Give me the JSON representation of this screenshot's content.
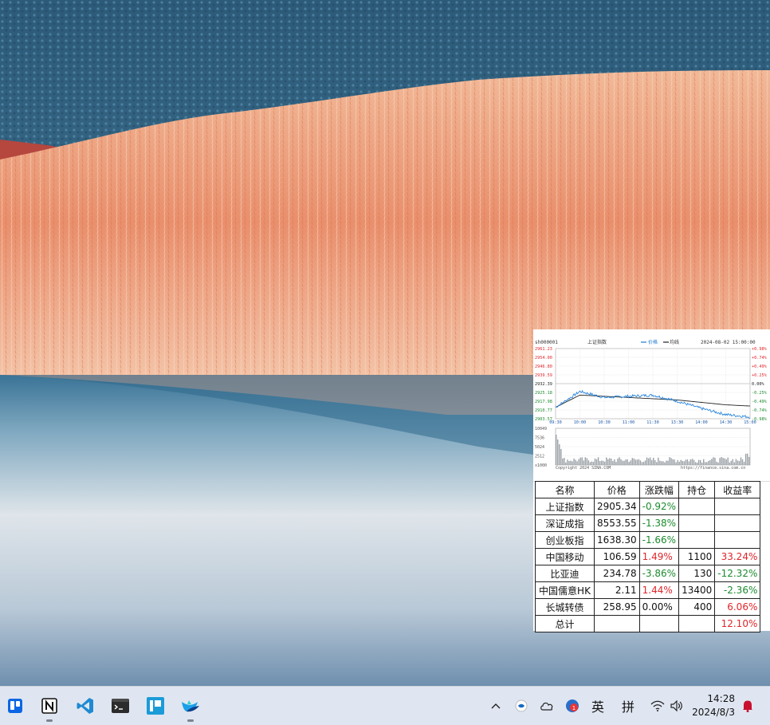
{
  "chart": {
    "symbol": "sh000001",
    "name": "上证指数",
    "legend_price": "价格",
    "legend_avg": "均线",
    "datetime": "2024-08-02 15:00:00",
    "left_ticks": [
      "2961.23",
      "2954.00",
      "2946.80",
      "2939.59",
      "2932.39",
      "2925.18",
      "2917.98",
      "2910.77",
      "2903.57"
    ],
    "right_ticks": [
      "+0.98%",
      "+0.74%",
      "+0.49%",
      "+0.25%",
      "0.00%",
      "-0.25%",
      "-0.49%",
      "-0.74%",
      "-0.98%"
    ],
    "time_ticks": [
      "09:30",
      "10:00",
      "10:30",
      "11:00",
      "11:30",
      "13:30",
      "14:00",
      "14:30",
      "15:00"
    ],
    "volume_ticks": [
      "10049",
      "7536",
      "5024",
      "2512",
      "x1000"
    ],
    "copyright": "Copyright 2024 SINA.COM",
    "source": "https://finance.sina.com.cn"
  },
  "chart_data": {
    "type": "line",
    "title": "上证指数",
    "x": [
      "09:30",
      "10:00",
      "10:30",
      "11:00",
      "11:30",
      "13:30",
      "14:00",
      "14:30",
      "15:00"
    ],
    "series": [
      {
        "name": "价格",
        "values": [
          2913,
          2926,
          2921,
          2922,
          2923,
          2918,
          2912,
          2907,
          2905
        ]
      },
      {
        "name": "均线",
        "values": [
          2913,
          2923,
          2922,
          2921,
          2920,
          2919,
          2917,
          2915,
          2914
        ]
      }
    ],
    "ylim": [
      2903.57,
      2961.23
    ],
    "grid": true
  },
  "table": {
    "headers": [
      "名称",
      "价格",
      "涨跌幅",
      "持仓",
      "收益率"
    ],
    "rows": [
      {
        "name": "上证指数",
        "price": "2905.34",
        "chg": "-0.92%",
        "hold": "",
        "ret": ""
      },
      {
        "name": "深证成指",
        "price": "8553.55",
        "chg": "-1.38%",
        "hold": "",
        "ret": ""
      },
      {
        "name": "创业板指",
        "price": "1638.30",
        "chg": "-1.66%",
        "hold": "",
        "ret": ""
      },
      {
        "name": "中国移动",
        "price": "106.59",
        "chg": "1.49%",
        "hold": "1100",
        "ret": "33.24%"
      },
      {
        "name": "比亚迪",
        "price": "234.78",
        "chg": "-3.86%",
        "hold": "130",
        "ret": "-12.32%"
      },
      {
        "name": "中国儒意HK",
        "price": "2.11",
        "chg": "1.44%",
        "hold": "13400",
        "ret": "-2.36%"
      },
      {
        "name": "长城转债",
        "price": "258.95",
        "chg": "0.00%",
        "hold": "400",
        "ret": "6.06%"
      },
      {
        "name": "总计",
        "price": "",
        "chg": "",
        "hold": "",
        "ret": "12.10%"
      }
    ]
  },
  "taskbar": {
    "apps": [
      "trello-icon",
      "notion-icon",
      "vscode-icon",
      "terminal-icon",
      "board-icon",
      "bird-icon"
    ],
    "tray": {
      "ime_lang": "英",
      "ime_mode": "拼",
      "notification_count": "1"
    },
    "time": "14:28",
    "date": "2024/8/3"
  }
}
